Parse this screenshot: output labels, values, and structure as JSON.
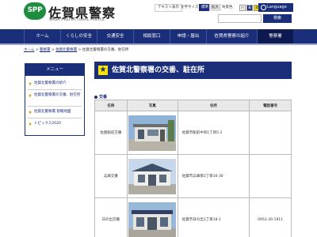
{
  "header": {
    "logo_text": "SPP",
    "title": "佐賀県警察",
    "subtitle": "SAGA PREFECTURAL POLICE",
    "text_mode_link": "テキスト表示",
    "font_size_label": "文字サイズ",
    "font_size_standard": "標準",
    "font_size_large": "拡大",
    "bg_color_label": "背景色",
    "bg_color_options": [
      "白",
      "青",
      "黄"
    ],
    "language_label": "Language",
    "search_placeholder": "",
    "search_button": "検索",
    "colors": {
      "brand": "#1b2e7a",
      "logo_green": "#1f8d3f",
      "accent": "#fde300"
    }
  },
  "nav": {
    "items": [
      {
        "label": "ホーム"
      },
      {
        "label": "くらしの安全"
      },
      {
        "label": "交通安全"
      },
      {
        "label": "相談窓口"
      },
      {
        "label": "申請・届出"
      },
      {
        "label": "佐賀県警察の紹介"
      },
      {
        "label": "警察署"
      }
    ],
    "active_index": 6
  },
  "breadcrumb": {
    "items": [
      "ホーム",
      "警察署",
      "佐賀北警察署",
      "佐賀北警察署の交番、駐在所"
    ],
    "separator": ">"
  },
  "sidebar": {
    "title": "メニュー",
    "items": [
      {
        "label": "佐賀北警察署の紹介"
      },
      {
        "label": "佐賀北警察署の交番、駐在所"
      },
      {
        "label": "佐賀北警察署 管轄地図"
      },
      {
        "label": "トピックス2020"
      }
    ]
  },
  "main": {
    "title": "佐賀北警察署の交番、駐在所",
    "section_label": "交番",
    "table": {
      "headers": [
        "名称",
        "写真",
        "住所",
        "電話番号"
      ],
      "rows": [
        {
          "name": "佐賀駅前交番",
          "address": "佐賀市駅前中央1丁目5-1",
          "phone": ""
        },
        {
          "name": "兵庫交番",
          "address": "佐賀市兵庫南3丁目16-30",
          "phone": ""
        },
        {
          "name": "日の出交番",
          "address": "佐賀市日の出1丁目18-1",
          "phone": "0952-30-1911"
        }
      ]
    }
  }
}
